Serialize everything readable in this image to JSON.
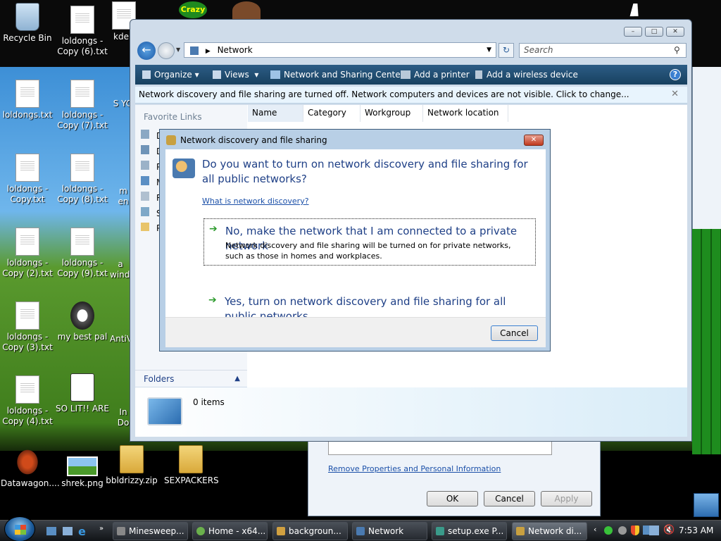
{
  "desktop": {
    "icons": [
      {
        "label": "Recycle Bin"
      },
      {
        "label": "loldongs - Copy (6).txt"
      },
      {
        "label": "kde f"
      },
      {
        "label": "Crazy"
      },
      {
        "label": "loldongs.txt"
      },
      {
        "label": "loldongs - Copy (7).txt"
      },
      {
        "label": "S YC"
      },
      {
        "label": "loldongs - Copy.txt"
      },
      {
        "label": "loldongs - Copy (8).txt"
      },
      {
        "label": "m en"
      },
      {
        "label": "loldongs - Copy (2).txt"
      },
      {
        "label": "loldongs - Copy (9).txt"
      },
      {
        "label": "a windo"
      },
      {
        "label": "loldongs - Copy (3).txt"
      },
      {
        "label": "my best pal"
      },
      {
        "label": "AntiV"
      },
      {
        "label": "loldongs - Copy (4).txt"
      },
      {
        "label": "SO LIT!! ARE"
      },
      {
        "label": "In Do"
      },
      {
        "label": "Datawagon...."
      },
      {
        "label": "shrek.png"
      },
      {
        "label": "bbldrizzy.zip"
      },
      {
        "label": "SEXPACKERS"
      }
    ]
  },
  "explorer": {
    "address": "Network",
    "search_placeholder": "Search",
    "commands": {
      "organize": "Organize",
      "views": "Views",
      "network_sharing": "Network and Sharing Center",
      "add_printer": "Add a printer",
      "add_wireless": "Add a wireless device"
    },
    "infobar": "Network discovery and file sharing are turned off. Network computers and devices are not visible. Click to change...",
    "favorite_links": "Favorite Links",
    "nav_items": [
      "D",
      "D",
      "P",
      "M",
      "R",
      "S",
      "P"
    ],
    "columns": [
      "Name",
      "Category",
      "Workgroup",
      "Network location"
    ],
    "folders_label": "Folders",
    "items_count": "0 items"
  },
  "dialog": {
    "title": "Network discovery and file sharing",
    "question": "Do you want to turn on network discovery and file sharing for all public networks?",
    "link": "What is network discovery?",
    "option1_title": "No, make the network that I am connected to a private network",
    "option1_desc": "Network discovery and file sharing will be turned on for private networks, such as those in homes and workplaces.",
    "option2_title": "Yes, turn on network discovery and file sharing for all public networks",
    "cancel": "Cancel"
  },
  "props_window": {
    "link": "Remove Properties and Personal Information",
    "ok": "OK",
    "cancel": "Cancel",
    "apply": "Apply"
  },
  "taskbar": {
    "items": [
      {
        "label": "Minesweep..."
      },
      {
        "label": "Home - x64..."
      },
      {
        "label": "backgroun..."
      },
      {
        "label": "Network"
      },
      {
        "label": "setup.exe P..."
      },
      {
        "label": "Network di..."
      }
    ],
    "clock": "7:53 AM"
  }
}
